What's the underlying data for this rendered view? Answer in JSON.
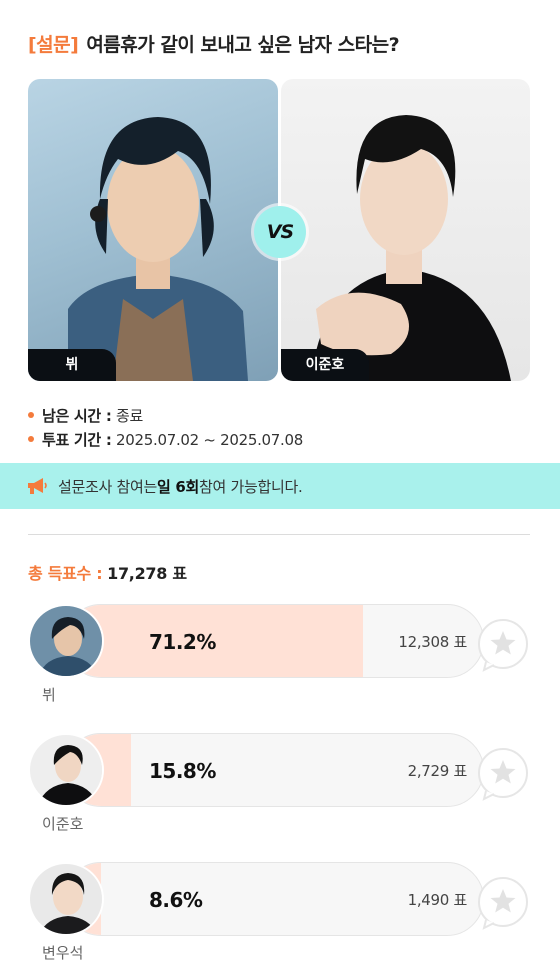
{
  "survey": {
    "tag": "[설문]",
    "question": "여름휴가 같이 보내고 싶은 남자 스타는?"
  },
  "matchup": {
    "left_name": "뷔",
    "right_name": "이준호",
    "vs_label": "VS"
  },
  "meta": {
    "remaining_label": "남은 시간 :",
    "remaining_value": "종료",
    "period_label": "투표 기간 :",
    "period_value": "2025.07.02 ~ 2025.07.08"
  },
  "notice": {
    "prefix": "설문조사 참여는 ",
    "highlight": "일 6회",
    "suffix": " 참여 가능합니다."
  },
  "total": {
    "label": "총 득표수 :",
    "value": "17,278 표"
  },
  "candidates": [
    {
      "name": "뷔",
      "percent_text": "71.2%",
      "percent": 71.2,
      "votes": "12,308 표"
    },
    {
      "name": "이준호",
      "percent_text": "15.8%",
      "percent": 15.8,
      "votes": "2,729 표"
    },
    {
      "name": "변우석",
      "percent_text": "8.6%",
      "percent": 8.6,
      "votes": "1,490 표"
    }
  ],
  "colors": {
    "accent": "#f47b3c",
    "notice_bg": "#a9f1ec",
    "bar_fill": "#ffe1d6"
  },
  "icons": {
    "notice": "megaphone-icon",
    "favorite": "star-bubble-icon"
  }
}
